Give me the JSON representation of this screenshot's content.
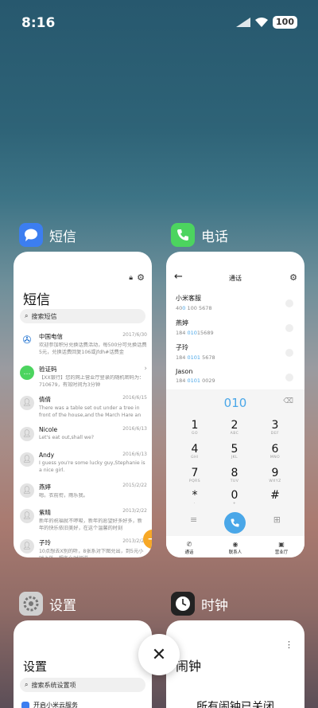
{
  "status": {
    "time": "8:16",
    "battery": "100"
  },
  "apps": {
    "messages": {
      "name": "短信",
      "title": "短信",
      "search_placeholder": "搜索短信",
      "items": [
        {
          "sender": "中国电信",
          "date": "2017/6/30",
          "preview": "欢迎参加积分兑换话费活动，每500分可兑换话费5元，兑换话费回复106或jfdh#话费金",
          "icon": "telecom"
        },
        {
          "sender": "验证码",
          "date": "",
          "preview": "【XX银行】您的网上营业厅登录的随机密码为：710679，有效时间为3分钟",
          "icon": "verify"
        },
        {
          "sender": "倩倩",
          "date": "2016/6/15",
          "preview": "There was a table set out under a tree in front of the house,and the March Hare an",
          "icon": "avatar"
        },
        {
          "sender": "Nicole",
          "date": "2016/6/13",
          "preview": "Let's eat out,shall we?",
          "icon": "avatar"
        },
        {
          "sender": "Andy",
          "date": "2016/6/13",
          "preview": "I guess you're some lucky guy,Stephanie is a nice girl.",
          "icon": "avatar"
        },
        {
          "sender": "燕婷",
          "date": "2015/2/22",
          "preview": "嗯。衣前衔，雨乐我。",
          "icon": "avatar"
        },
        {
          "sender": "紫晴",
          "date": "2013/2/22",
          "preview": "新年的祝福就不啰唆，新年的愿望好多好多，新年的快乐依旧美好，在这个温馨的时刻",
          "icon": "avatar"
        },
        {
          "sender": "子玲",
          "date": "2013/2/22",
          "preview": "10点想去X别的听，8张系对下图兑出，到5元小时上外，想各么时间说",
          "icon": "avatar"
        }
      ]
    },
    "phone": {
      "name": "电话",
      "title": "通话",
      "contacts": [
        {
          "name": "小米客服",
          "num_pre": "40",
          "num_hl": "0",
          "num_post": " 100 5678"
        },
        {
          "name": "燕婷",
          "num_pre": "184 ",
          "num_hl": "010",
          "num_post": "15689"
        },
        {
          "name": "子玲",
          "num_pre": "184 ",
          "num_hl": "0101",
          "num_post": " 5678"
        },
        {
          "name": "Jason",
          "num_pre": "184 ",
          "num_hl": "0101",
          "num_post": " 0029"
        }
      ],
      "dialed": "010",
      "keys": [
        {
          "d": "1",
          "l": "GO"
        },
        {
          "d": "2",
          "l": "ABC"
        },
        {
          "d": "3",
          "l": "DEF"
        },
        {
          "d": "4",
          "l": "GHI"
        },
        {
          "d": "5",
          "l": "JKL"
        },
        {
          "d": "6",
          "l": "MNO"
        },
        {
          "d": "7",
          "l": "PQRS"
        },
        {
          "d": "8",
          "l": "TUV"
        },
        {
          "d": "9",
          "l": "WXYZ"
        },
        {
          "d": "*",
          "l": "·"
        },
        {
          "d": "0",
          "l": "+"
        },
        {
          "d": "#",
          "l": ""
        }
      ],
      "tabs": [
        "通话",
        "联系人",
        "营业厅"
      ]
    },
    "settings": {
      "name": "设置",
      "title": "设置",
      "search_placeholder": "搜索系统设置项",
      "item": "开启小米云服务"
    },
    "clock": {
      "name": "时钟",
      "title": "闹钟",
      "empty": "所有闹钟已关闭"
    }
  },
  "colors": {
    "accent": "#4aa7e8",
    "fab": "#f7a826"
  }
}
